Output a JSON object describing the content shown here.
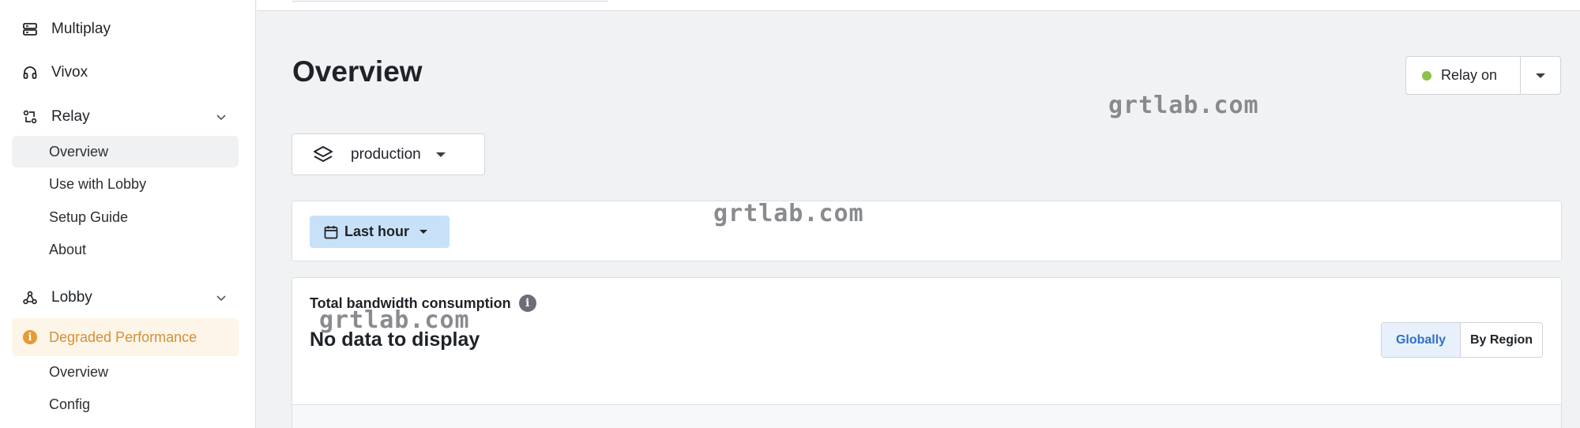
{
  "sidebar": {
    "items": [
      {
        "label": "Multiplay",
        "icon": "server-icon"
      },
      {
        "label": "Vivox",
        "icon": "headset-icon"
      },
      {
        "label": "Relay",
        "icon": "relay-icon",
        "expanded": true
      },
      {
        "label": "Lobby",
        "icon": "lobby-icon",
        "expanded": true
      }
    ],
    "relay_sub": [
      "Overview",
      "Use with Lobby",
      "Setup Guide",
      "About"
    ],
    "degraded": "Degraded Performance",
    "lobby_sub": [
      "Overview",
      "Config"
    ]
  },
  "main": {
    "title": "Overview",
    "relay_status": "Relay on",
    "environment": "production",
    "time_range": "Last hour",
    "bandwidth": {
      "title": "Total bandwidth consumption",
      "empty": "No data to display",
      "toggle": [
        "Globally",
        "By Region"
      ],
      "toggle_selected": "Globally"
    }
  },
  "watermark": "grtlab.com",
  "colors": {
    "accent": "#2f6fc4",
    "time_button": "#c8e1f8",
    "relay_status": "#8bc34a",
    "warning": "#e59a3a"
  }
}
